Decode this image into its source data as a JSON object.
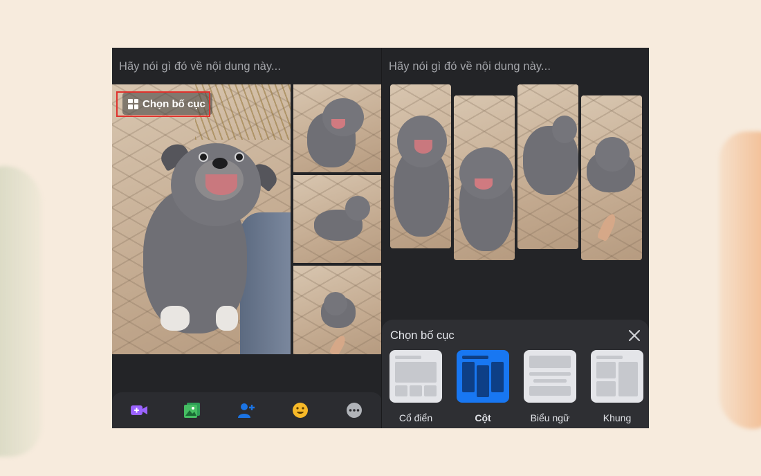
{
  "left_screen": {
    "caption_placeholder": "Hãy nói gì đó về nội dung này...",
    "layout_button": "Chọn bố cục",
    "toolbar": [
      "video-icon",
      "photo-icon",
      "tag-people-icon",
      "emoji-icon",
      "more-icon"
    ]
  },
  "right_screen": {
    "caption_placeholder": "Hãy nói gì đó về nội dung này...",
    "layout_sheet": {
      "title": "Chọn bố cục",
      "options": [
        {
          "label": "Cổ điển",
          "selected": false
        },
        {
          "label": "Cột",
          "selected": true
        },
        {
          "label": "Biểu ngữ",
          "selected": false
        },
        {
          "label": "Khung",
          "selected": false
        }
      ]
    }
  },
  "colors": {
    "background": "#f7ebdd",
    "screen": "#232427",
    "accent": "#1877f2",
    "highlight": "#e0312c"
  }
}
